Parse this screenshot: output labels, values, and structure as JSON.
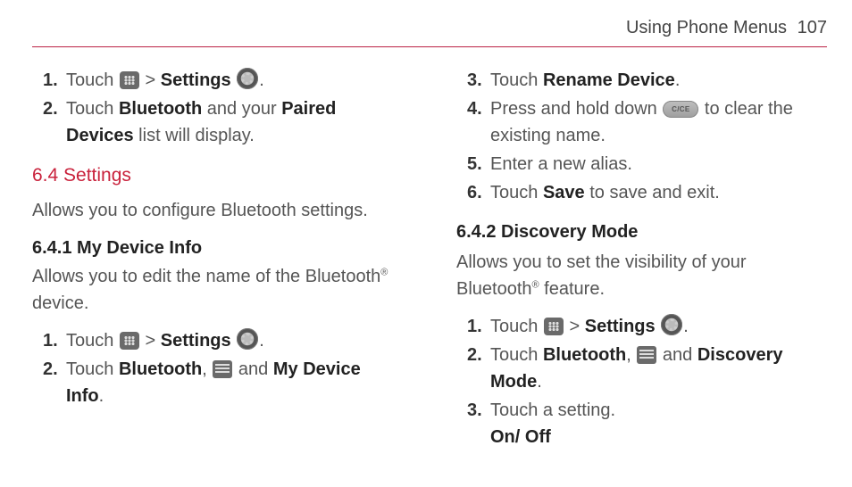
{
  "header": {
    "section": "Using Phone Menus",
    "page": "107"
  },
  "left": {
    "intro_steps": [
      {
        "n": "1.",
        "pre": "Touch ",
        "mid": " > ",
        "bold1": "Settings",
        "post": " ",
        "tail": "."
      },
      {
        "n": "2.",
        "pre": "Touch ",
        "bold1": "Bluetooth",
        "mid1": " and your ",
        "bold2": "Paired Devices",
        "post": " list will display."
      }
    ],
    "section_title": "6.4 Settings",
    "section_desc": "Allows you to configure Bluetooth settings.",
    "sub_title": "6.4.1 My Device Info",
    "sub_desc_pre": "Allows you to edit the name of the Bluetooth",
    "sub_desc_post": " device.",
    "sub_steps": [
      {
        "n": "1.",
        "pre": "Touch ",
        "mid": " > ",
        "bold1": "Settings",
        "post": " ",
        "tail": "."
      },
      {
        "n": "2.",
        "pre": "Touch ",
        "bold1": "Bluetooth",
        "mid1": ", ",
        "mid2": " and ",
        "bold2": "My Device Info",
        "post": "."
      }
    ]
  },
  "right": {
    "steps_a": [
      {
        "n": "3.",
        "pre": "Touch ",
        "bold1": "Rename Device",
        "post": "."
      },
      {
        "n": "4.",
        "pre": "Press and hold down ",
        "post": " to clear the existing name."
      },
      {
        "n": "5.",
        "text": "Enter a new alias."
      },
      {
        "n": "6.",
        "pre": "Touch ",
        "bold1": "Save",
        "post": " to save and exit."
      }
    ],
    "sub_title": "6.4.2 Discovery Mode",
    "sub_desc_pre": "Allows you to set the visibility of your Bluetooth",
    "sub_desc_post": " feature.",
    "steps_b": [
      {
        "n": "1.",
        "pre": "Touch ",
        "mid": " > ",
        "bold1": "Settings",
        "post": " ",
        "tail": "."
      },
      {
        "n": "2.",
        "pre": "Touch ",
        "bold1": "Bluetooth",
        "mid1": ", ",
        "mid2": " and ",
        "bold2": "Discovery Mode",
        "post": "."
      },
      {
        "n": "3.",
        "text": "Touch a setting.",
        "line2": "On/ Off"
      }
    ]
  }
}
